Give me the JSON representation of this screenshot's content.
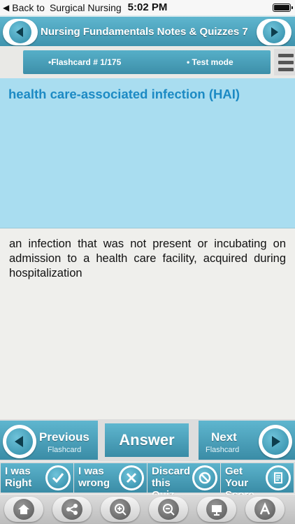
{
  "status_bar": {
    "back_label": "Back to",
    "app_name": "Surgical Nursing",
    "time": "5:02 PM"
  },
  "header": {
    "title": "Nursing Fundamentals Notes & Quizzes 7"
  },
  "sub_bar": {
    "flashcard": "•Flashcard #  1/175",
    "mode": "• Test mode"
  },
  "card": {
    "question": "health care-associated infection (HAI)",
    "answer": "an infection that was not present or incubating on admission to a health care facility, acquired during hospitalization"
  },
  "nav": {
    "previous_label": "Previous",
    "previous_sub": "Flashcard",
    "answer_label": "Answer",
    "next_label": "Next",
    "next_sub": "Flashcard"
  },
  "actions": {
    "right_label": "I was\nRight",
    "wrong_label": "I was\nwrong",
    "discard_label": "Discard\nthis Quiz",
    "score_label": "Get Your\nScore"
  },
  "toolbar_icons": [
    "home-icon",
    "share-icon",
    "zoom-in-icon",
    "zoom-out-icon",
    "presentation-icon",
    "font-size-icon"
  ],
  "colors": {
    "accent": "#4aa4bf",
    "question_bg": "#a9ddf0",
    "question_text": "#1c8ac4"
  }
}
